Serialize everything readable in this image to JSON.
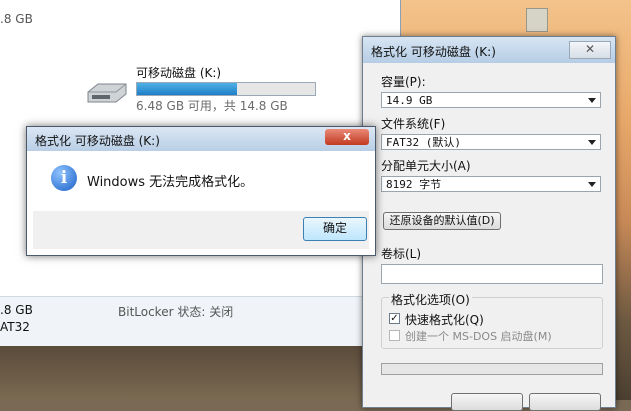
{
  "desktop": {
    "folder_icon": "folder-icon"
  },
  "explorer": {
    "top_text": ".8 GB",
    "drive": {
      "name": "可移动磁盘 (K:)",
      "space": "6.48 GB 可用，共 14.8 GB",
      "used_fraction": 0.56,
      "icon": "usb-drive-icon"
    },
    "details": {
      "size": ".8 GB",
      "fs": "AT32",
      "bitlocker": "BitLocker 状态: 关闭"
    }
  },
  "format_window": {
    "title": "格式化 可移动磁盘 (K:)",
    "capacity_label": "容量(P):",
    "capacity_value": "14.9 GB",
    "filesystem_label": "文件系统(F)",
    "filesystem_value": "FAT32 (默认)",
    "alloc_label": "分配单元大小(A)",
    "alloc_value": "8192 字节",
    "restore_button": "还原设备的默认值(D)",
    "volume_label": "卷标(L)",
    "volume_value": "",
    "options_label": "格式化选项(O)",
    "quick_format": {
      "label": "快速格式化(Q)",
      "checked": true
    },
    "msdos_disk": {
      "label": "创建一个 MS-DOS 启动盘(M)",
      "checked": false,
      "enabled": false
    }
  },
  "error_dialog": {
    "title": "格式化 可移动磁盘 (K:)",
    "close": "x",
    "icon": "info-icon",
    "message": "Windows 无法完成格式化。",
    "ok_button": "确定"
  }
}
